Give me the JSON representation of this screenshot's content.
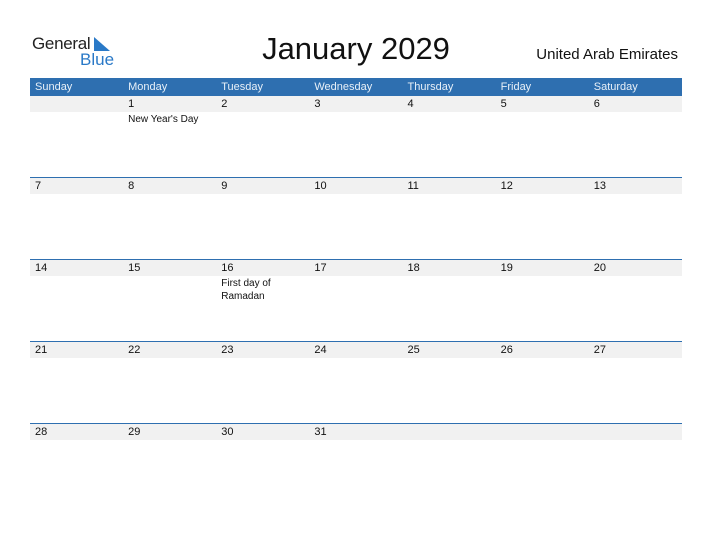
{
  "logo": {
    "word1": "General",
    "word2": "Blue"
  },
  "title": "January 2029",
  "country": "United Arab Emirates",
  "days": [
    "Sunday",
    "Monday",
    "Tuesday",
    "Wednesday",
    "Thursday",
    "Friday",
    "Saturday"
  ],
  "weeks": [
    {
      "dates": [
        "",
        "1",
        "2",
        "3",
        "4",
        "5",
        "6"
      ],
      "events": [
        "",
        "New Year's Day",
        "",
        "",
        "",
        "",
        ""
      ]
    },
    {
      "dates": [
        "7",
        "8",
        "9",
        "10",
        "11",
        "12",
        "13"
      ],
      "events": [
        "",
        "",
        "",
        "",
        "",
        "",
        ""
      ]
    },
    {
      "dates": [
        "14",
        "15",
        "16",
        "17",
        "18",
        "19",
        "20"
      ],
      "events": [
        "",
        "",
        "First day of Ramadan",
        "",
        "",
        "",
        ""
      ]
    },
    {
      "dates": [
        "21",
        "22",
        "23",
        "24",
        "25",
        "26",
        "27"
      ],
      "events": [
        "",
        "",
        "",
        "",
        "",
        "",
        ""
      ]
    },
    {
      "dates": [
        "28",
        "29",
        "30",
        "31",
        "",
        "",
        ""
      ],
      "events": [
        "",
        "",
        "",
        "",
        "",
        "",
        ""
      ]
    }
  ]
}
